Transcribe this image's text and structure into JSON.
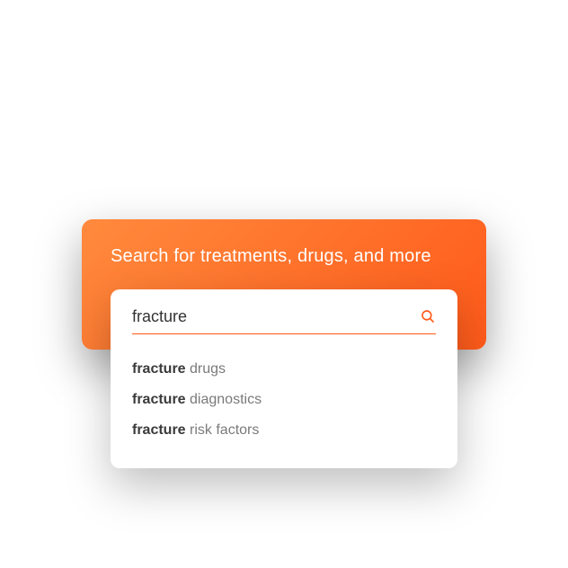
{
  "header": {
    "title": "Search for treatments, drugs, and more"
  },
  "search": {
    "value": "fracture",
    "placeholder": ""
  },
  "suggestions": [
    {
      "bold": "fracture",
      "rest": " drugs"
    },
    {
      "bold": "fracture",
      "rest": " diagnostics"
    },
    {
      "bold": "fracture",
      "rest": " risk factors"
    }
  ],
  "colors": {
    "accent": "#ff5a1a"
  }
}
